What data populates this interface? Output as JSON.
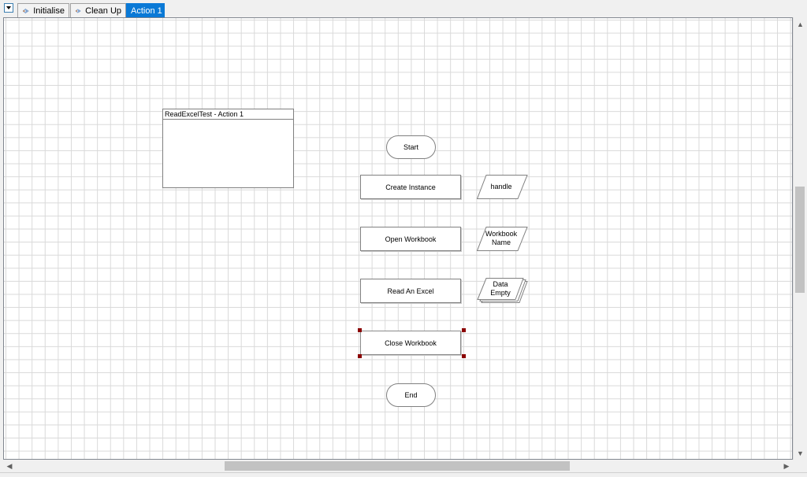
{
  "tabs": {
    "items": [
      {
        "label": "Initialise",
        "icon": "page-icon"
      },
      {
        "label": "Clean Up",
        "icon": "page-icon"
      },
      {
        "label": "Action 1",
        "icon": null,
        "active": true
      }
    ]
  },
  "note": {
    "title": "ReadExcelTest - Action 1"
  },
  "flow": {
    "start": "Start",
    "end": "End",
    "stages": [
      {
        "label": "Create Instance"
      },
      {
        "label": "Open Workbook"
      },
      {
        "label": "Read An Excel"
      },
      {
        "label": "Close Workbook",
        "selected": true
      }
    ],
    "data_items": [
      {
        "label": "handle",
        "type": "data"
      },
      {
        "label": "Workbook\nName",
        "type": "data"
      },
      {
        "label": "Data\nEmpty",
        "type": "collection"
      }
    ]
  },
  "colors": {
    "active_tab": "#0a79d6",
    "grid": "#d9d9d9",
    "selection_handle": "#8b0000"
  }
}
